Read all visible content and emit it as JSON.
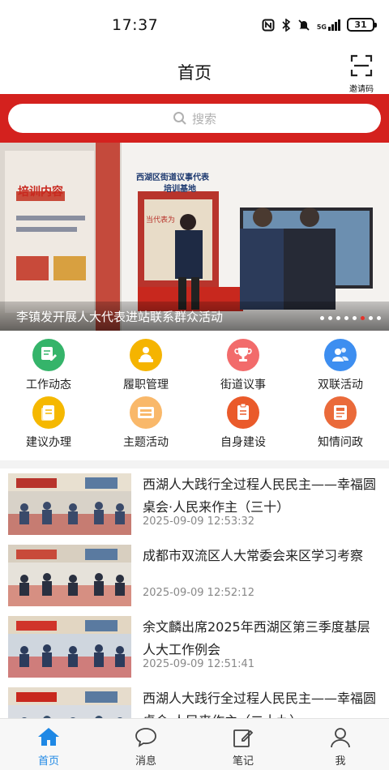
{
  "status_bar": {
    "time": "17:37",
    "network": "5G",
    "battery": "31"
  },
  "header": {
    "title": "首页",
    "invite_label": "邀请码"
  },
  "search": {
    "placeholder": "搜索"
  },
  "banner": {
    "caption": "李镇发开展人大代表进站联系群众活动",
    "slide_count": 8,
    "active_slide": 5
  },
  "banner_image_text": {
    "board": "培训内容",
    "sign_line1": "西湖区街道议事代表",
    "sign_line2": "培训基地",
    "wall": "当代表为"
  },
  "quick_menu": [
    {
      "label": "工作动态",
      "icon": "edit-doc-icon",
      "color": "#35b46a"
    },
    {
      "label": "履职管理",
      "icon": "person-desk-icon",
      "color": "#f5b400"
    },
    {
      "label": "街道议事",
      "icon": "trophy-icon",
      "color": "#f26b6b"
    },
    {
      "label": "双联活动",
      "icon": "people-icon",
      "color": "#3d8ef0"
    },
    {
      "label": "建议办理",
      "icon": "document-stack-icon",
      "color": "#f5b800"
    },
    {
      "label": "主题活动",
      "icon": "card-icon",
      "color": "#f9b86a"
    },
    {
      "label": "自身建设",
      "icon": "clipboard-icon",
      "color": "#ea5a2a"
    },
    {
      "label": "知情问政",
      "icon": "id-card-icon",
      "color": "#ea6a3a"
    }
  ],
  "news": [
    {
      "title": "西湖人大践行全过程人民民主——幸福圆桌会·人民来作主（三十）",
      "time": "2025-09-09 12:53:32"
    },
    {
      "title": "成都市双流区人大常委会来区学习考察",
      "time": "2025-09-09 12:52:12"
    },
    {
      "title": "余文麟出席2025年西湖区第三季度基层人大工作例会",
      "time": "2025-09-09 12:51:41"
    },
    {
      "title": "西湖人大践行全过程人民民主——幸福圆桌会·人民来作主（二十九）",
      "time": ""
    }
  ],
  "tab_bar": [
    {
      "label": "首页",
      "icon": "home-icon",
      "active": true
    },
    {
      "label": "消息",
      "icon": "chat-bubble-icon",
      "active": false
    },
    {
      "label": "笔记",
      "icon": "note-edit-icon",
      "active": false
    },
    {
      "label": "我",
      "icon": "user-icon",
      "active": false
    }
  ],
  "colors": {
    "brand_red": "#d4211e",
    "active_blue": "#1e88e5"
  }
}
